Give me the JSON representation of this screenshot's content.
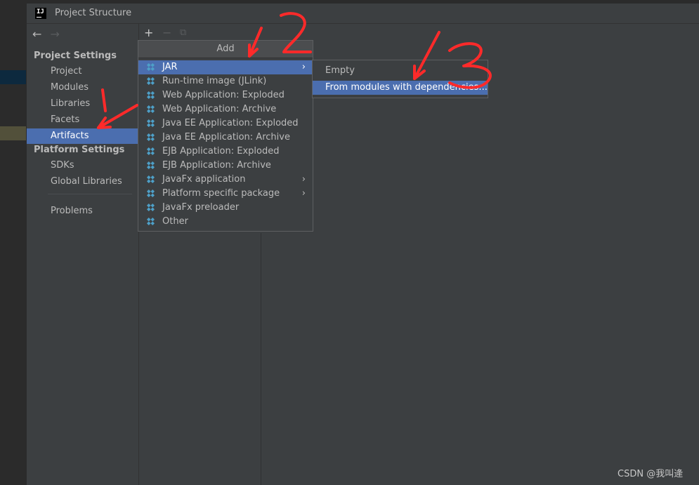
{
  "window": {
    "title": "Project Structure"
  },
  "sidebar": {
    "sections": [
      {
        "title": "Project Settings",
        "items": [
          "Project",
          "Modules",
          "Libraries",
          "Facets",
          "Artifacts"
        ]
      },
      {
        "title": "Platform Settings",
        "items": [
          "SDKs",
          "Global Libraries"
        ]
      }
    ],
    "selected": "Artifacts",
    "problems": "Problems"
  },
  "toolbar": {
    "add": "+",
    "remove": "−",
    "copy": "⧉"
  },
  "add_popup": {
    "title": "Add",
    "items": [
      {
        "label": "JAR",
        "has_submenu": true,
        "active": true
      },
      {
        "label": "Run-time image (JLink)"
      },
      {
        "label": "Web Application: Exploded"
      },
      {
        "label": "Web Application: Archive"
      },
      {
        "label": "Java EE Application: Exploded"
      },
      {
        "label": "Java EE Application: Archive"
      },
      {
        "label": "EJB Application: Exploded"
      },
      {
        "label": "EJB Application: Archive"
      },
      {
        "label": "JavaFx application",
        "has_submenu": true
      },
      {
        "label": "Platform specific package",
        "has_submenu": true
      },
      {
        "label": "JavaFx preloader"
      },
      {
        "label": "Other"
      }
    ]
  },
  "jar_submenu": {
    "items": [
      "Empty",
      "From modules with dependencies..."
    ],
    "active": "From modules with dependencies..."
  },
  "annotations": {
    "step1": "1",
    "step2": "2",
    "step3": "3",
    "color": "#ff2a2a"
  },
  "watermark": "CSDN @我叫逄",
  "colors": {
    "selection": "#4b6eaf",
    "panel": "#3c3f41",
    "icon": "#4ea0c8"
  }
}
